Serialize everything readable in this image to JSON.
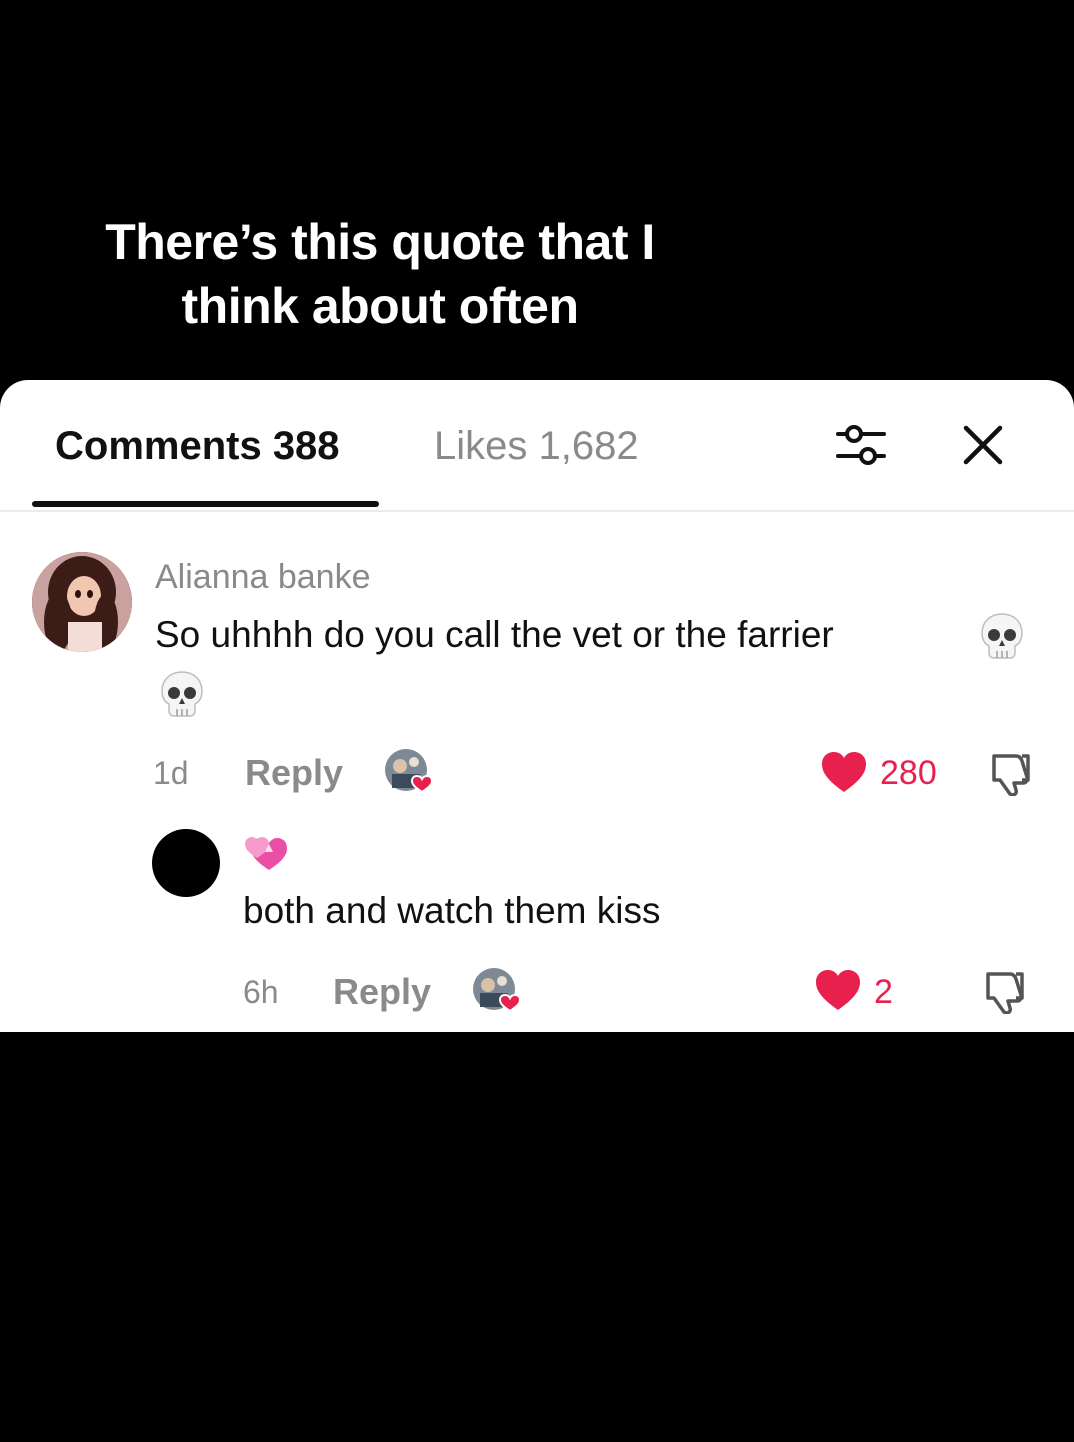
{
  "caption": {
    "line1": "There’s this quote that I",
    "line2": "think about often"
  },
  "tabs": {
    "comments": "Comments 388",
    "likes": "Likes 1,682"
  },
  "icons": {
    "filter": "filter-sliders-icon",
    "close": "close-icon",
    "heart": "heart-icon",
    "dislike": "thumbs-down-icon",
    "skull": "skull-emoji",
    "hearts": "two-hearts-emoji"
  },
  "colors": {
    "like": "#e8204d",
    "muted": "#8a8a8a",
    "text": "#111111"
  },
  "comment": {
    "username": "Alianna banke",
    "text": "So uhhhh do you call the vet or the farrier",
    "age": "1d",
    "reply_label": "Reply",
    "likes": "280"
  },
  "reply": {
    "text": "both and watch them kiss",
    "age": "6h",
    "reply_label": "Reply",
    "likes": "2"
  }
}
